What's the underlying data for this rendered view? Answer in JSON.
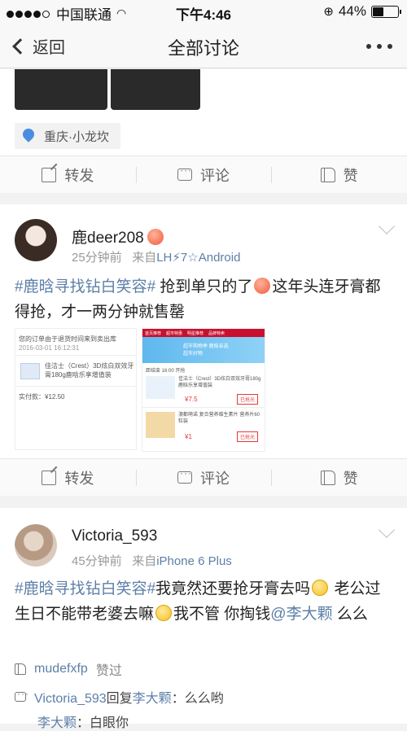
{
  "status": {
    "carrier": "中国联通",
    "time": "下午4:46",
    "battery": "44%",
    "battery_level": 0.44
  },
  "nav": {
    "back": "返回",
    "title": "全部讨论"
  },
  "post0": {
    "location": "重庆·小龙坎",
    "share": "转发",
    "comment": "评论",
    "like": "赞"
  },
  "post1": {
    "user": "鹿deer208",
    "time": "25分钟前",
    "from_prefix": "来自",
    "source": "LH⚡7☆Android",
    "tag": "#鹿晗寻找钻白笑容#",
    "text1": "抢到单只的了",
    "text2": "这年头连牙膏都得抢，才一两分钟就售罄",
    "shot1": {
      "header": "您的订单由于退货时间来到卖出库",
      "date": "2016-03-01 16:12:31",
      "product": "佳洁士（Crest）3D炫白双效牙膏180g鹿晗乐享增值装",
      "paid": "实付款：¥12.50"
    },
    "shot2": {
      "tabs": [
        "首页推荐",
        "超市特惠",
        "明星推荐",
        "品牌特卖"
      ],
      "banner": "超市购物季 鹿晗亲选超市好物",
      "countdown": "距结束 16:00 开抢",
      "item1_name": "佳洁士（Crest）3D炫白双效牙膏180g鹿晗乐享增值装",
      "item1_price": "¥7.5",
      "item1_btn": "已抢光",
      "item2_name": "澳都萌诺 复合营养维生素片 营养片60粒装",
      "item2_price": "¥1",
      "item2_btn": "已抢光"
    },
    "share": "转发",
    "comment": "评论",
    "like": "赞"
  },
  "post2": {
    "user": "Victoria_593",
    "time": "45分钟前",
    "from_prefix": "来自",
    "source": "iPhone 6 Plus",
    "tag": "#鹿晗寻找钻白笑容#",
    "text1": "我竟然还要抢牙膏去吗",
    "text2": "老公过生日不能带老婆去嘛",
    "text3": "我不管 你掏钱",
    "mention": "@李大颗",
    "text4": " 么么",
    "like_user": "mudefxfp",
    "like_text": "赞过",
    "reply1_user": "Victoria_593",
    "reply1_mid": "回复",
    "reply1_target": "李大颗",
    "reply1_text": "：么么哟",
    "reply2_user": "李大颗",
    "reply2_text": "：白眼你"
  }
}
